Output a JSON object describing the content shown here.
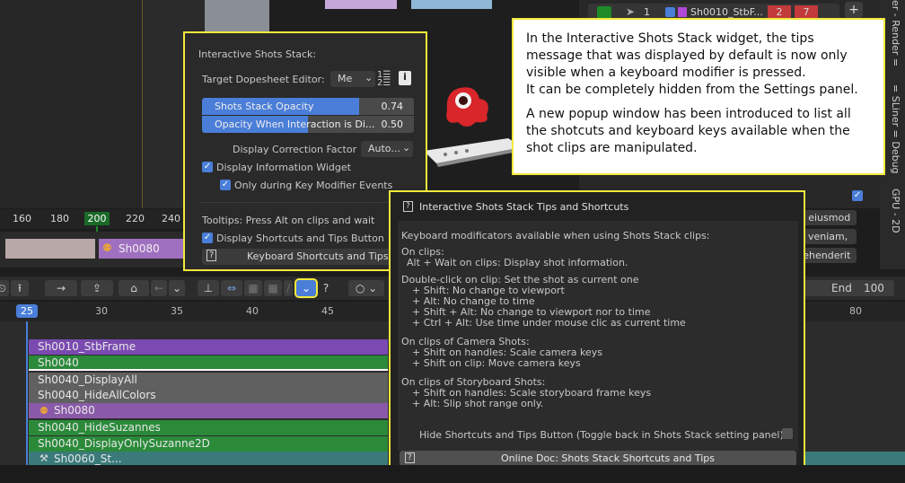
{
  "outliner": {
    "counts": [
      "1",
      "2",
      "7"
    ],
    "shot_name": "Sh0010_StbF..."
  },
  "side_tabs": [
    "er - Render =",
    "= SLiner = Debug",
    "GPU - 2D"
  ],
  "right_buttons": [
    "o eiusmod",
    "veniam,",
    "rehenderit"
  ],
  "ruler_top": [
    "160",
    "180",
    "200",
    "220",
    "240"
  ],
  "track_top_label": "Sh0080",
  "shots_panel": {
    "title": "Interactive Shots Stack:",
    "target_label": "Target Dopesheet Editor:",
    "target_value": "Me",
    "opacity_label": "Shots Stack Opacity",
    "opacity_value": "0.74",
    "opacity_fraction": 0.74,
    "interaction_label": "Opacity When Interaction is Di...",
    "interaction_value": "0.50",
    "interaction_fraction": 0.5,
    "correction_label": "Display Correction Factor",
    "correction_value": "Auto...",
    "info_widget": "Display Information Widget",
    "key_modifier_only": "Only during Key Modifier Events",
    "tooltips": "Tooltips: Press Alt on clips and wait",
    "display_shortcuts": "Display Shortcuts and Tips Button",
    "keyboard_button": "Keyboard Shortcuts and Tips"
  },
  "note": {
    "p1": "In the Interactive Shots Stack widget, the tips message that was displayed by default is now only visible when a keyboard modifier is pressed.",
    "p2": "It can be completely hidden from the Settings panel.",
    "p3": "A new popup window has been introduced to list all the shotcuts and keyboard keys available when the shot clips are manipulated."
  },
  "tips_popup": {
    "title": "Interactive Shots Stack Tips and Shortcuts",
    "intro": "Keyboard modificators available when using Shots Stack clips:",
    "on_clips_header": "On clips:",
    "on_clips": [
      "Alt + Wait on clips: Display shot information."
    ],
    "double_click_header": "Double-click on clip: Set the shot as current one",
    "double_click": [
      "+ Shift:  No change to viewport",
      "+ Alt:  No change to time",
      "+ Shift + Alt:  No change to viewport nor to time",
      "+ Ctrl + Alt:  Use time under mouse clic as current time"
    ],
    "camera_header": "On clips of Camera Shots:",
    "camera": [
      "+ Shift on handles: Scale camera keys",
      "+ Shift on clip: Move camera keys"
    ],
    "storyboard_header": "On clips of Storyboard Shots:",
    "storyboard": [
      "+ Shift on handles: Scale storyboard frame keys",
      "+ Alt: Slip shot range only."
    ],
    "hide_label": "Hide Shortcuts and Tips Button (Toggle back in Shots Stack setting panel)",
    "doc_button": "Online Doc: Shots Stack Shortcuts and Tips"
  },
  "toolbar": {
    "end_label": "End",
    "end_value": "100"
  },
  "ruler": {
    "current": "25",
    "ticks": [
      "30",
      "35",
      "40",
      "45",
      "80"
    ]
  },
  "tracks": [
    "Sh0010_StbFrame",
    "Sh0040",
    "Sh0040_DisplayAll",
    "Sh0040_HideAllColors",
    "Sh0080",
    "Sh0040_HideSuzannes",
    "Sh0040_DisplayOnlySuzanne2D",
    "Sh0060_St..."
  ]
}
